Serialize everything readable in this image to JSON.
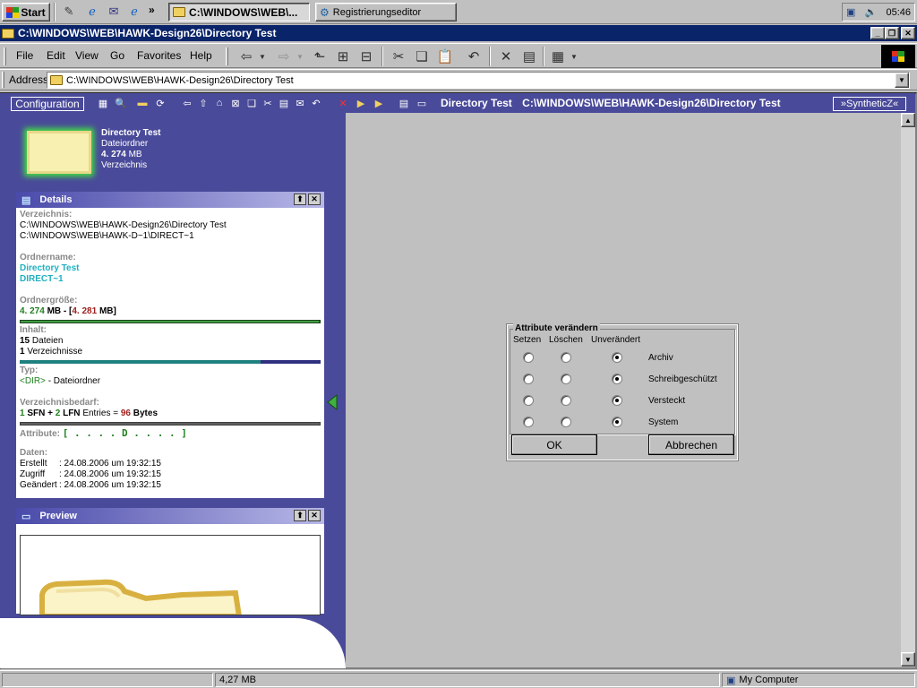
{
  "taskbar": {
    "start_label": "Start",
    "chevron": "»",
    "tasks": [
      {
        "label": "C:\\WINDOWS\\WEB\\...",
        "active": true
      },
      {
        "label": "Registrierungseditor",
        "active": false
      }
    ],
    "clock": "05:46"
  },
  "window": {
    "title": "C:\\WINDOWS\\WEB\\HAWK-Design26\\Directory Test"
  },
  "menu": {
    "items": [
      "File",
      "Edit",
      "View",
      "Go",
      "Favorites",
      "Help"
    ]
  },
  "address": {
    "label": "Address",
    "value": "C:\\WINDOWS\\WEB\\HAWK-Design26\\Directory Test"
  },
  "webview": {
    "config_label": "Configuration",
    "header_name": "Directory Test",
    "header_path": "C:\\WINDOWS\\WEB\\HAWK-Design26\\Directory Test",
    "synthetic_label": "»SyntheticZ«"
  },
  "folder": {
    "name": "Directory Test",
    "type": "Dateiordner",
    "size_value": "4. 274",
    "size_unit": "MB",
    "kind": "Verzeichnis"
  },
  "details": {
    "title": "Details",
    "verzeichnis_label": "Verzeichnis:",
    "path_long": "C:\\WINDOWS\\WEB\\HAWK-Design26\\Directory Test",
    "path_short": "C:\\WINDOWS\\WEB\\HAWK-D~1\\DIRECT~1",
    "ordnername_label": "Ordnername:",
    "name_long": "Directory Test",
    "name_short": "DIRECT~1",
    "groesse_label": "Ordnergröße:",
    "size1": "4. 274",
    "size1_unit": "MB - [",
    "size2": "4. 281",
    "size2_unit": "MB]",
    "size_ratio": 0.998,
    "inhalt_label": "Inhalt:",
    "files_count": "15",
    "files_label": "Dateien",
    "dirs_count": "1",
    "dirs_label": "Verzeichnisse",
    "typ_label": "Typ:",
    "typ_value": "<DIR>",
    "typ_desc": "- Dateiordner",
    "bedarf_label": "Verzeichnisbedarf:",
    "sfn_count": "1",
    "sfn_label": "SFN +",
    "lfn_count": "2",
    "lfn_label": "LFN",
    "entries_label": "Entries =",
    "bytes_count": "96",
    "bytes_label": "Bytes",
    "attribute_label": "Attribute:",
    "attribute_value": "[ . . . . D . . . . ]",
    "daten_label": "Daten:",
    "created_label": "Erstellt",
    "created_value": ": 24.08.2006 um 19:32:15",
    "access_label": "Zugriff",
    "access_value": ": 24.08.2006 um 19:32:15",
    "modified_label": "Geändert",
    "modified_value": ": 24.08.2006 um 19:32:15"
  },
  "preview": {
    "title": "Preview"
  },
  "dialog": {
    "title": "Attribute verändern",
    "col_set": "Setzen",
    "col_clear": "Löschen",
    "col_unchanged": "Unverändert",
    "attributes": [
      {
        "label": "Archiv",
        "state": "unchanged"
      },
      {
        "label": "Schreibgeschützt",
        "state": "unchanged"
      },
      {
        "label": "Versteckt",
        "state": "unchanged"
      },
      {
        "label": "System",
        "state": "unchanged"
      }
    ],
    "ok_label": "OK",
    "cancel_label": "Abbrechen"
  },
  "status": {
    "size": "4,27 MB",
    "zone": "My Computer"
  },
  "colors": {
    "titlebar": "#0a246a",
    "panel_bg": "#4a4a9a",
    "cyan": "#20b0c0",
    "green": "#208020",
    "red": "#a02020"
  }
}
